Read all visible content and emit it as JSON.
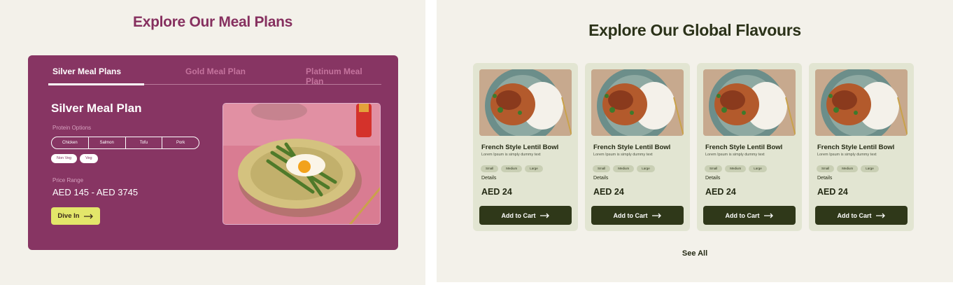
{
  "meal_plans": {
    "title": "Explore Our Meal Plans",
    "tabs": [
      {
        "label": "Silver Meal Plans"
      },
      {
        "label": "Gold Meal Plan"
      },
      {
        "label": "Platinum Meal Plan"
      }
    ],
    "plan_title": "Silver Meal Plan",
    "protein_label": "Protein Options",
    "proteins": [
      "Chicken",
      "Salmon",
      "Tofu",
      "Pork"
    ],
    "diets": [
      "Non Veg",
      "Veg"
    ],
    "price_label": "Price Range",
    "price": "AED 145 - AED 3745",
    "cta": "Dive In"
  },
  "flavours": {
    "title": "Explore Our Global Flavours",
    "cards": [
      {
        "name": "French Style Lentil Bowl",
        "desc": "Lorem Ipsum is simply dummy text",
        "sizes": [
          "Small",
          "Medium",
          "Large"
        ],
        "details": "Details",
        "price": "AED 24",
        "button": "Add to Cart"
      },
      {
        "name": "French Style Lentil Bowl",
        "desc": "Lorem Ipsum is simply dummy text",
        "sizes": [
          "Small",
          "Medium",
          "Large"
        ],
        "details": "Details",
        "price": "AED 24",
        "button": "Add to Cart"
      },
      {
        "name": "French Style Lentil Bowl",
        "desc": "Lorem Ipsum is simply dummy text",
        "sizes": [
          "Small",
          "Medium",
          "Large"
        ],
        "details": "Details",
        "price": "AED 24",
        "button": "Add to Cart"
      },
      {
        "name": "French Style Lentil Bowl",
        "desc": "Lorem Ipsum is simply dummy text",
        "sizes": [
          "Small",
          "Medium",
          "Large"
        ],
        "details": "Details",
        "price": "AED 24",
        "button": "Add to Cart"
      }
    ],
    "see_all": "See All"
  },
  "colors": {
    "plum": "#873563",
    "plum_title": "#86305f",
    "lime_cta": "#e3e66a",
    "olive_dark": "#2f3819",
    "sage_card": "#e2e5d2",
    "cream_bg": "#f3f1ea"
  },
  "icons": {
    "cta_arrow": "arrow-right-icon",
    "cart_arrow": "arrow-right-icon"
  }
}
